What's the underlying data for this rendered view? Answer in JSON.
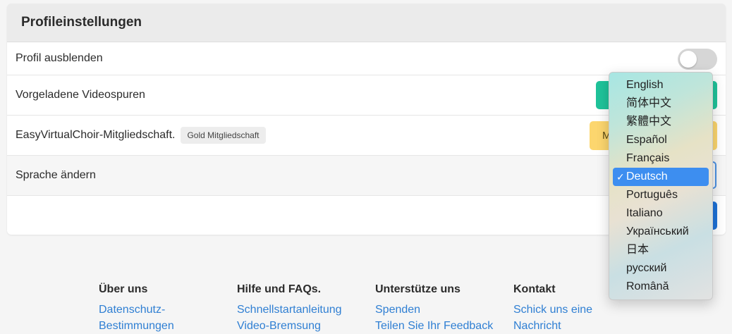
{
  "card": {
    "title": "Profileinstellungen",
    "rows": {
      "hide_profile": "Profil ausblenden",
      "preloaded_tracks": "Vorgeladene Videospuren",
      "membership": "EasyVirtualChoir-Mitgliedschaft.",
      "membership_badge": "Gold Mitgliedschaft",
      "change_language": "Sprache ändern"
    },
    "membership_button_text": "M",
    "hide_profile_toggle": "off"
  },
  "language_dropdown": {
    "options": [
      "English",
      "简体中文",
      "繁體中文",
      "Español",
      "Français",
      "Deutsch",
      "Português",
      "Italiano",
      "Український",
      "日本",
      "русский",
      "Română"
    ],
    "selected": "Deutsch",
    "check_mark": "✓"
  },
  "footer": {
    "columns": [
      {
        "heading": "Über uns",
        "links": [
          "Datenschutz-",
          "Bestimmungen"
        ]
      },
      {
        "heading": "Hilfe und FAQs.",
        "links": [
          "Schnellstartanleitung",
          "Video-Bremsung"
        ]
      },
      {
        "heading": "Unterstütze uns",
        "links": [
          "Spenden",
          "Teilen Sie Ihr Feedback"
        ]
      },
      {
        "heading": "Kontakt",
        "links": [
          "Schick uns eine",
          "Nachricht"
        ]
      }
    ]
  },
  "colors": {
    "teal_button": "#1fc39a",
    "yellow_button": "#fcd66e",
    "blue_button": "#1d72d8",
    "link": "#2f7fd3",
    "selection": "#3d8ef0"
  }
}
